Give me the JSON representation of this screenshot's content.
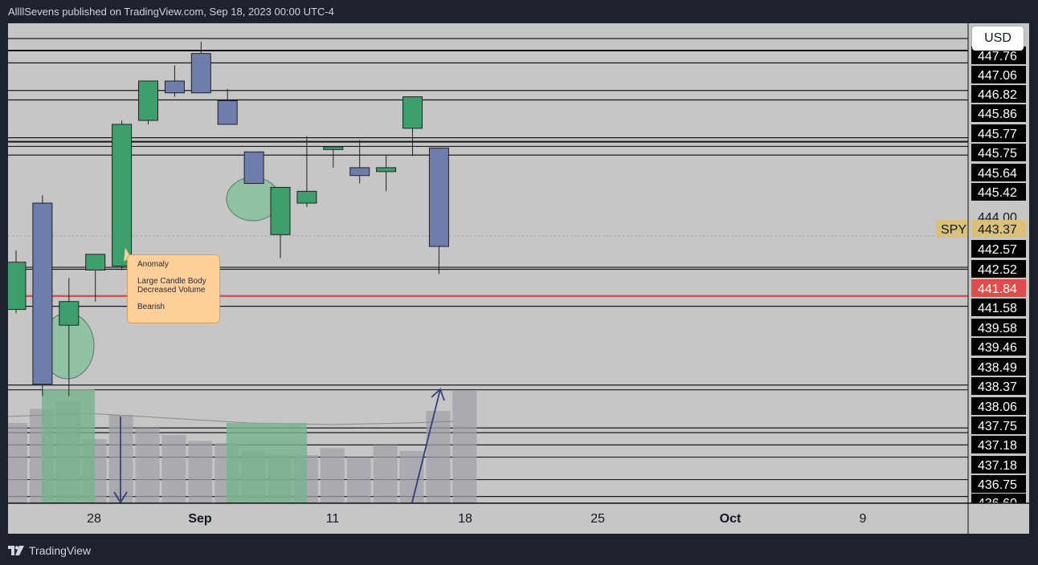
{
  "header": {
    "publish_line": "AllllSevens published on TradingView.com, Sep 18, 2023 00:00 UTC-4"
  },
  "currency_button": "USD",
  "footer": {
    "brand": "TradingView"
  },
  "annotation": {
    "title": "Anomaly",
    "line1": "Large Candle Body",
    "line2": "Decreased Volume",
    "line3": "Bearish"
  },
  "price_scale": {
    "labels": [
      "447.76",
      "447.06",
      "446.82",
      "445.86",
      "445.77",
      "445.75",
      "445.64",
      "445.42",
      "444.00",
      "442.57",
      "442.52",
      "441.58",
      "439.58",
      "439.46",
      "438.49",
      "438.37",
      "438.06",
      "437.75",
      "437.18",
      "437.18",
      "436.75",
      "436.60"
    ],
    "symbol_tag": {
      "symbol": "SPY",
      "price": "443.37"
    },
    "red_tag": "441.84"
  },
  "colors": {
    "up": "#3e9e6c",
    "down": "#6d7dac",
    "red_line": "#e04b4b",
    "volume": "#a0a0a8",
    "volume_highlight": "#74b48e",
    "circle": "#7bbf95",
    "arrow": "#333f7a"
  },
  "chart_data": {
    "type": "candlestick",
    "symbol": "SPY",
    "time_labels": [
      "28",
      "Sep",
      "11",
      "18",
      "25",
      "Oct",
      "9"
    ],
    "candles": [
      {
        "o": 441.5,
        "h": 443.0,
        "l": 441.4,
        "c": 442.7
      },
      {
        "o": 444.2,
        "h": 444.4,
        "l": 439.3,
        "c": 439.6
      },
      {
        "o": 441.1,
        "h": 442.3,
        "l": 439.3,
        "c": 441.7
      },
      {
        "o": 442.5,
        "h": 442.9,
        "l": 441.7,
        "c": 442.9
      },
      {
        "o": 442.6,
        "h": 446.3,
        "l": 442.5,
        "c": 446.2
      },
      {
        "o": 446.3,
        "h": 447.3,
        "l": 446.2,
        "c": 447.3
      },
      {
        "o": 447.3,
        "h": 447.7,
        "l": 446.9,
        "c": 447.0
      },
      {
        "o": 448.0,
        "h": 448.3,
        "l": 447.0,
        "c": 447.0
      },
      {
        "o": 446.8,
        "h": 447.1,
        "l": 446.2,
        "c": 446.2
      },
      {
        "o": 445.5,
        "h": 445.5,
        "l": 444.7,
        "c": 444.7
      },
      {
        "o": 443.4,
        "h": 443.6,
        "l": 442.8,
        "c": 444.6
      },
      {
        "o": 444.2,
        "h": 445.9,
        "l": 444.1,
        "c": 444.5
      },
      {
        "o": 445.56,
        "h": 445.6,
        "l": 445.1,
        "c": 445.63
      },
      {
        "o": 445.1,
        "h": 445.8,
        "l": 444.7,
        "c": 444.9
      },
      {
        "o": 445.0,
        "h": 445.4,
        "l": 444.5,
        "c": 445.1
      },
      {
        "o": 446.1,
        "h": 446.6,
        "l": 445.4,
        "c": 446.9
      },
      {
        "o": 445.6,
        "h": 445.4,
        "l": 442.4,
        "c": 443.1
      }
    ],
    "volume": [
      80,
      94,
      102,
      64,
      88,
      75,
      68,
      62,
      60,
      52,
      48,
      48,
      55,
      46,
      58,
      52,
      92,
      112
    ],
    "volume_range": [
      0,
      120
    ],
    "price_range": [
      436.6,
      448.4
    ],
    "horizontal_levels": [
      447.76,
      447.06,
      446.82,
      445.86,
      445.77,
      445.75,
      445.64,
      445.42,
      442.57,
      442.52,
      441.58,
      439.58,
      439.46,
      438.49,
      438.37,
      438.06,
      437.75,
      437.18,
      436.75
    ],
    "highlight_line": 441.84,
    "last_price": 443.37
  }
}
